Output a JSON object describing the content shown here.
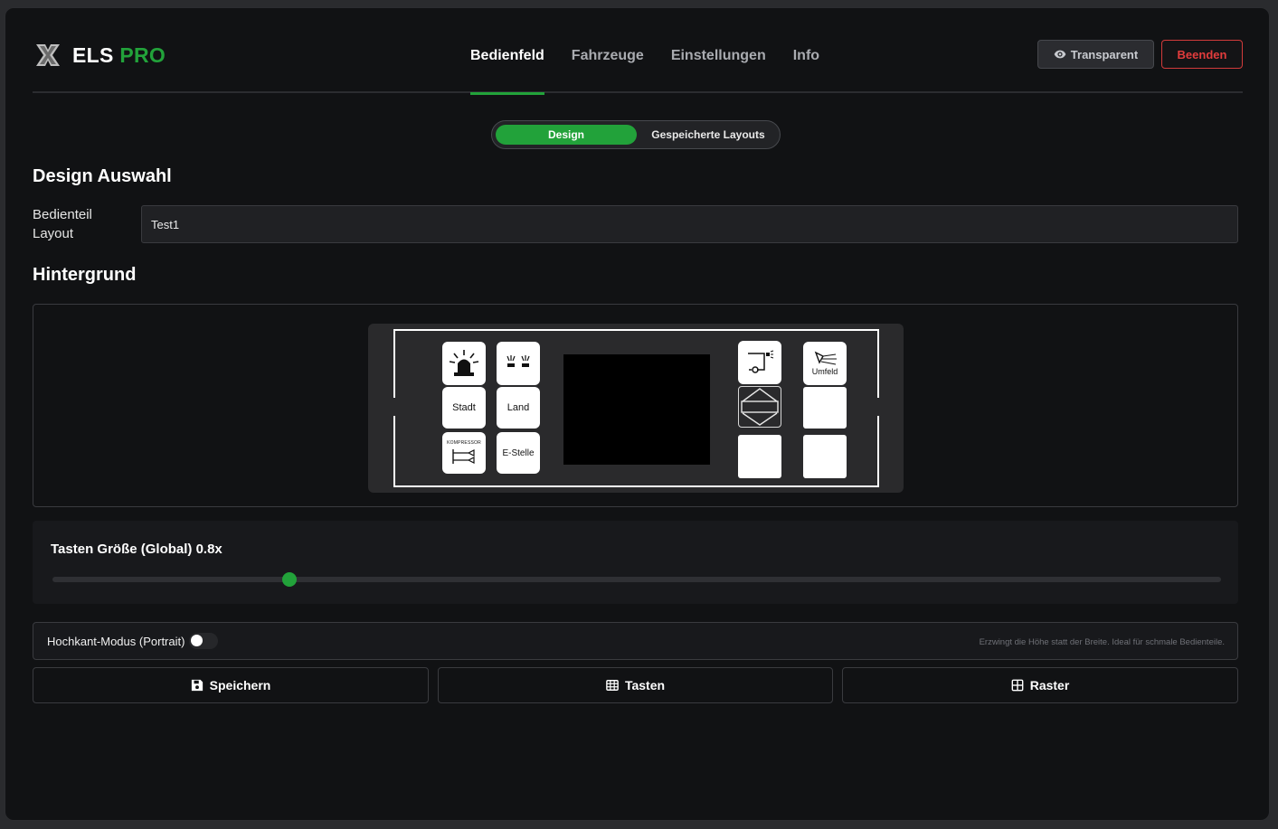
{
  "app": {
    "logo_main": "ELS",
    "logo_accent": "PRO",
    "accent_color": "#22a23a",
    "danger_color": "#d23b3b"
  },
  "nav": {
    "items": [
      "Bedienfeld",
      "Fahrzeuge",
      "Einstellungen",
      "Info"
    ],
    "active_index": 0
  },
  "header_buttons": {
    "transparent": "Transparent",
    "end": "Beenden"
  },
  "mode_toggle": {
    "design": "Design",
    "saved_layouts": "Gespeicherte Layouts",
    "active": "Design"
  },
  "design_section": {
    "title": "Design Auswahl",
    "layout_label": "Bedienteil Layout",
    "layout_value": "Test1"
  },
  "background_section": {
    "title": "Hintergrund",
    "keys": {
      "stadt": "Stadt",
      "land": "Land",
      "kompressor_small": "KOMPRESSOR",
      "e_stelle": "E-Stelle",
      "umfeld": "Umfeld"
    }
  },
  "slider": {
    "label": "Tasten Größe (Global) 0.8x",
    "value_fraction": 0.203
  },
  "portrait": {
    "label": "Hochkant-Modus (Portrait)",
    "enabled": false,
    "hint": "Erzwingt die Höhe statt der Breite. Ideal für schmale Bedienteile."
  },
  "actions": {
    "save": "Speichern",
    "keys": "Tasten",
    "grid": "Raster"
  }
}
